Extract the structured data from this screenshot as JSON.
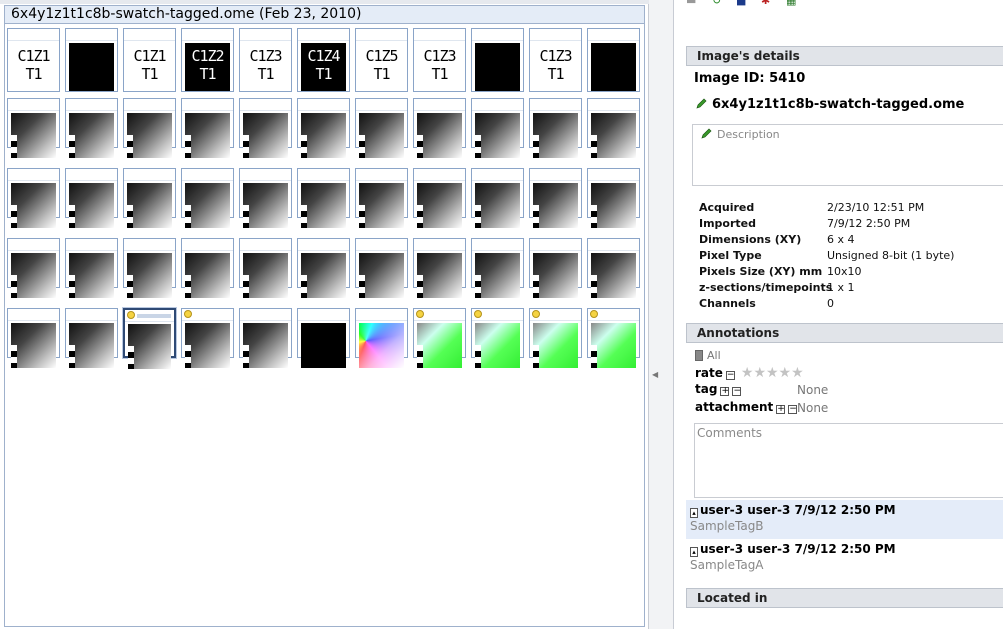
{
  "browser": {
    "title": "6x4y1z1t1c8b-swatch-tagged.ome (Feb 23, 2010)",
    "rows": [
      [
        {
          "kind": "text",
          "line1": "C1Z1",
          "line2": "T1",
          "inv": false
        },
        {
          "kind": "black"
        },
        {
          "kind": "text",
          "line1": "C1Z1",
          "line2": "T1",
          "inv": false
        },
        {
          "kind": "text",
          "line1": "C1Z2",
          "line2": "T1",
          "inv": true
        },
        {
          "kind": "text",
          "line1": "C1Z3",
          "line2": "T1",
          "inv": false
        },
        {
          "kind": "text",
          "line1": "C1Z4",
          "line2": "T1",
          "inv": true
        },
        {
          "kind": "text",
          "line1": "C1Z5",
          "line2": "T1",
          "inv": false
        },
        {
          "kind": "text",
          "line1": "C1Z3",
          "line2": "T1",
          "inv": false
        },
        {
          "kind": "black"
        },
        {
          "kind": "text",
          "line1": "C1Z3",
          "line2": "T1",
          "inv": false
        },
        {
          "kind": "black"
        }
      ],
      [
        {
          "kind": "grad"
        },
        {
          "kind": "grad"
        },
        {
          "kind": "grad"
        },
        {
          "kind": "grad"
        },
        {
          "kind": "grad"
        },
        {
          "kind": "grad"
        },
        {
          "kind": "grad"
        },
        {
          "kind": "grad"
        },
        {
          "kind": "grad"
        },
        {
          "kind": "grad"
        },
        {
          "kind": "grad"
        }
      ],
      [
        {
          "kind": "grad"
        },
        {
          "kind": "grad"
        },
        {
          "kind": "grad"
        },
        {
          "kind": "grad"
        },
        {
          "kind": "grad"
        },
        {
          "kind": "grad"
        },
        {
          "kind": "grad"
        },
        {
          "kind": "grad"
        },
        {
          "kind": "grad"
        },
        {
          "kind": "grad"
        },
        {
          "kind": "grad"
        }
      ],
      [
        {
          "kind": "grad"
        },
        {
          "kind": "grad"
        },
        {
          "kind": "grad"
        },
        {
          "kind": "grad"
        },
        {
          "kind": "grad"
        },
        {
          "kind": "grad"
        },
        {
          "kind": "grad"
        },
        {
          "kind": "grad"
        },
        {
          "kind": "grad"
        },
        {
          "kind": "grad"
        },
        {
          "kind": "grad"
        }
      ],
      [
        {
          "kind": "grad"
        },
        {
          "kind": "grad"
        },
        {
          "kind": "grad",
          "selected": true,
          "annotated": true
        },
        {
          "kind": "grad",
          "annotated": true
        },
        {
          "kind": "grad"
        },
        {
          "kind": "black"
        },
        {
          "kind": "rainbow"
        },
        {
          "kind": "green",
          "annotated": true
        },
        {
          "kind": "green",
          "annotated": true
        },
        {
          "kind": "green",
          "annotated": true
        },
        {
          "kind": "green",
          "annotated": true
        }
      ]
    ]
  },
  "details": {
    "section_title": "Image's details",
    "image_id": "Image ID: 5410",
    "image_name": "6x4y1z1t1c8b-swatch-tagged.ome",
    "description_placeholder": "Description",
    "properties": [
      {
        "key": "Acquired",
        "value": "2/23/10 12:51 PM"
      },
      {
        "key": "Imported",
        "value": "7/9/12 2:50 PM"
      },
      {
        "key": "Dimensions (XY)",
        "value": "6 x 4"
      },
      {
        "key": "Pixel Type",
        "value": "Unsigned 8-bit (1 byte)"
      },
      {
        "key": "Pixels Size (XY) mm",
        "value": "10x10"
      },
      {
        "key": "z-sections/timepoints",
        "value": "1 x 1"
      },
      {
        "key": "Channels",
        "value": "0"
      }
    ]
  },
  "annotations": {
    "section_title": "Annotations",
    "filter_label": "All",
    "rate_label": "rate",
    "rating_stars": "★★★★★",
    "tag_label": "tag",
    "tag_value": "None",
    "attachment_label": "attachment",
    "attachment_value": "None",
    "comments_placeholder": "Comments",
    "tags": [
      {
        "user": "user-3 user-3 7/9/12 2:50 PM",
        "name": "SampleTagB",
        "highlighted": true
      },
      {
        "user": "user-3 user-3 7/9/12 2:50 PM",
        "name": "SampleTagA",
        "highlighted": false
      }
    ]
  },
  "located_in": {
    "section_title": "Located in"
  },
  "colors": {
    "selection_border": "#2f4a75",
    "header_bg": "#e1e4e9",
    "highlight_bg": "#e4ecf9",
    "thumb_border": "#8aa4c8"
  }
}
